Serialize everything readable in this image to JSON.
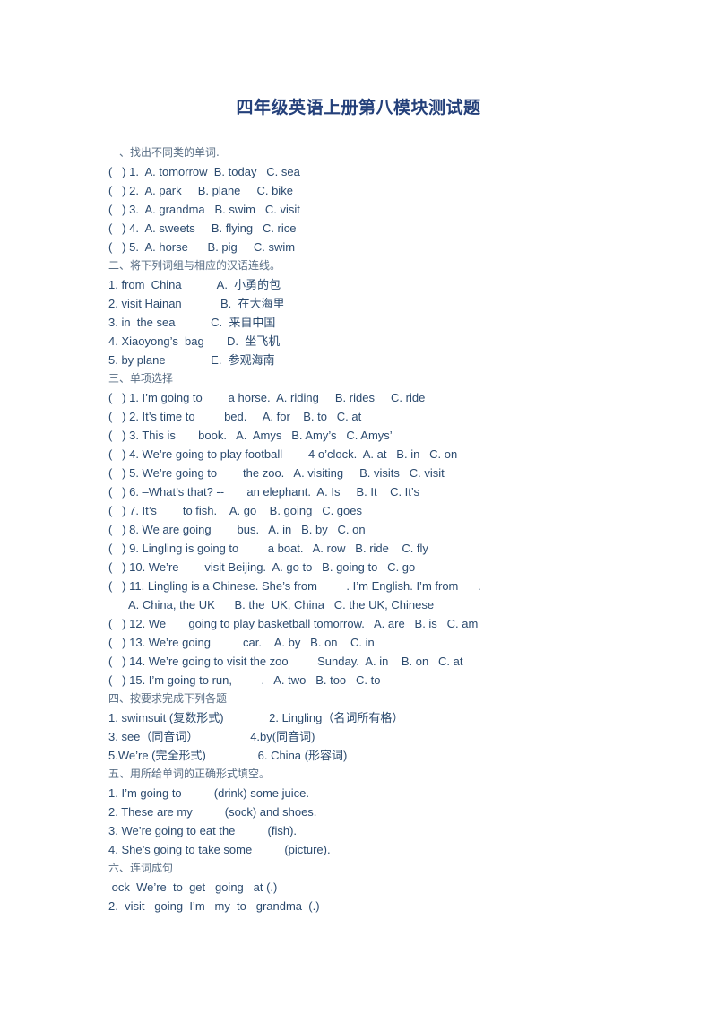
{
  "document": {
    "title": "四年级英语上册第八模块测试题",
    "sections": [
      {
        "heading": "一、找出不同类的单词.",
        "lines": [
          "(   ) 1.  A. tomorrow  B. today   C. sea",
          "(   ) 2.  A. park     B. plane     C. bike",
          "(   ) 3.  A. grandma   B. swim   C. visit",
          "(   ) 4.  A. sweets     B. flying   C. rice",
          "(   ) 5.  A. horse      B. pig     C. swim"
        ]
      },
      {
        "heading": "二、将下列词组与相应的汉语连线。",
        "lines": [
          "1. from  China           A.  小勇的包",
          "2. visit Hainan            B.  在大海里",
          "3. in  the sea           C.  来自中国",
          "4. Xiaoyong’s  bag       D.  坐飞机",
          "5. by plane              E.  参观海南"
        ]
      },
      {
        "heading": "三、单项选择",
        "lines": [
          "(   ) 1. I’m going to        a horse.  A. riding     B. rides     C. ride",
          "(   ) 2. It’s time to         bed.     A. for    B. to   C. at",
          "(   ) 3. This is       book.   A.  Amys   B. Amy’s   C. Amys’",
          "(   ) 4. We’re going to play football        4 o’clock.  A. at   B. in   C. on",
          "(   ) 5. We’re going to        the zoo.   A. visiting     B. visits   C. visit",
          "(   ) 6. –What’s that? --       an elephant.  A. Is     B. It    C. It’s",
          "(   ) 7. It’s        to fish.    A. go    B. going   C. goes",
          "(   ) 8. We are going        bus.   A. in   B. by   C. on",
          "(   ) 9. Lingling is going to         a boat.   A. row   B. ride    C. fly",
          "(   ) 10. We’re        visit Beijing.  A. go to   B. going to   C. go",
          "(   ) 11. Lingling is a Chinese. She’s from         . I’m English. I’m from      ."
        ],
        "continuation": "A. China, the UK      B. the  UK, China   C. the UK, Chinese",
        "lines_after": [
          "(   ) 12. We       going to play basketball tomorrow.   A. are   B. is   C. am",
          "(   ) 13. We’re going          car.    A. by   B. on    C. in",
          "(   ) 14. We’re going to visit the zoo         Sunday.  A. in    B. on   C. at",
          "(   ) 15. I’m going to run,         .   A. two   B. too   C. to"
        ]
      },
      {
        "heading": "四、按要求完成下列各题",
        "lines": [
          "1. swimsuit (复数形式)              2. Lingling（名词所有格）",
          "3. see（同音词）                4.by(同音词)",
          "5.We’re (完全形式)                6. China (形容词)"
        ]
      },
      {
        "heading": "五、用所给单词的正确形式填空。",
        "lines": [
          "1. I’m going to          (drink) some juice.",
          "2. These are my          (sock) and shoes.",
          "3. We’re going to eat the          (fish).",
          "4. She’s going to take some          (picture)."
        ]
      },
      {
        "heading": "六、连词成句",
        "lines": [
          " ock  We’re  to  get   going   at (.)",
          "2.  visit   going  I’m   my  to   grandma  (.)"
        ]
      }
    ]
  }
}
